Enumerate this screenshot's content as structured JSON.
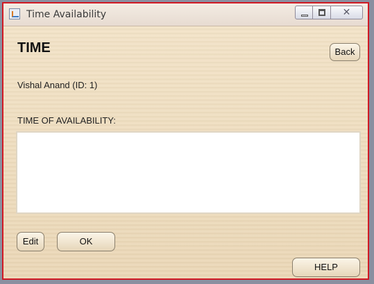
{
  "window": {
    "title": "Time Availability",
    "icon": "java-app-icon",
    "controls": {
      "minimize": "minimize-icon",
      "maximize": "maximize-icon",
      "close_symbol": "✕"
    }
  },
  "header": {
    "title": "TIME",
    "back_label": "Back"
  },
  "person": {
    "label": "Vishal Anand (ID: 1)"
  },
  "availability": {
    "label": "TIME OF AVAILABILITY:",
    "value": ""
  },
  "buttons": {
    "edit": "Edit",
    "ok": "OK",
    "help": "HELP"
  },
  "colors": {
    "window_border": "#d11a24",
    "panel_background": "#f2e2c6",
    "titlebar": "#efe6dc"
  }
}
